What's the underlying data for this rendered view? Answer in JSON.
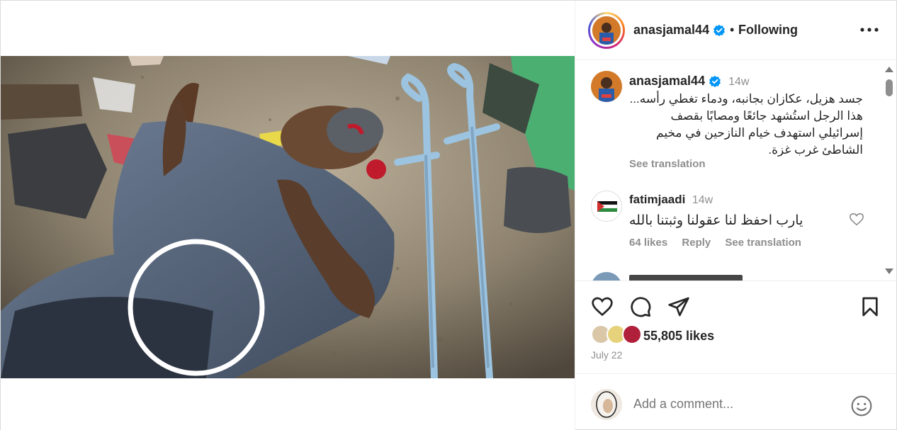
{
  "post": {
    "author": "anasjamal44",
    "follow_status": "Following",
    "separator": "•"
  },
  "caption": {
    "username": "anasjamal44",
    "time": "14w",
    "text": "جسد هزيل، عكازان بجانبه، ودماء تغطي رأسه... هذا الرجل استُشهد جائعًا ومصابًا بقصف إسرائيلي استهدف خيام النازحين في مخيم الشاطئ غرب غزة.",
    "see_translation": "See translation"
  },
  "comments": [
    {
      "username": "fatimjaadi",
      "time": "14w",
      "text": "يارب احفظ لنا عقولنا وثبتنا بالله",
      "likes": "64 likes",
      "reply": "Reply",
      "see_translation": "See translation"
    }
  ],
  "engagement": {
    "likes": "55,805 likes",
    "date": "July 22"
  },
  "composer": {
    "placeholder": "Add a comment..."
  },
  "colors": {
    "verified": "#0095f6",
    "muted": "#8e8e8e",
    "text": "#262626"
  },
  "icons": [
    "verified-badge-icon",
    "more-options-icon",
    "heart-icon",
    "comment-icon",
    "share-icon",
    "save-icon",
    "emoji-icon",
    "scroll-up-icon",
    "scroll-down-icon"
  ]
}
